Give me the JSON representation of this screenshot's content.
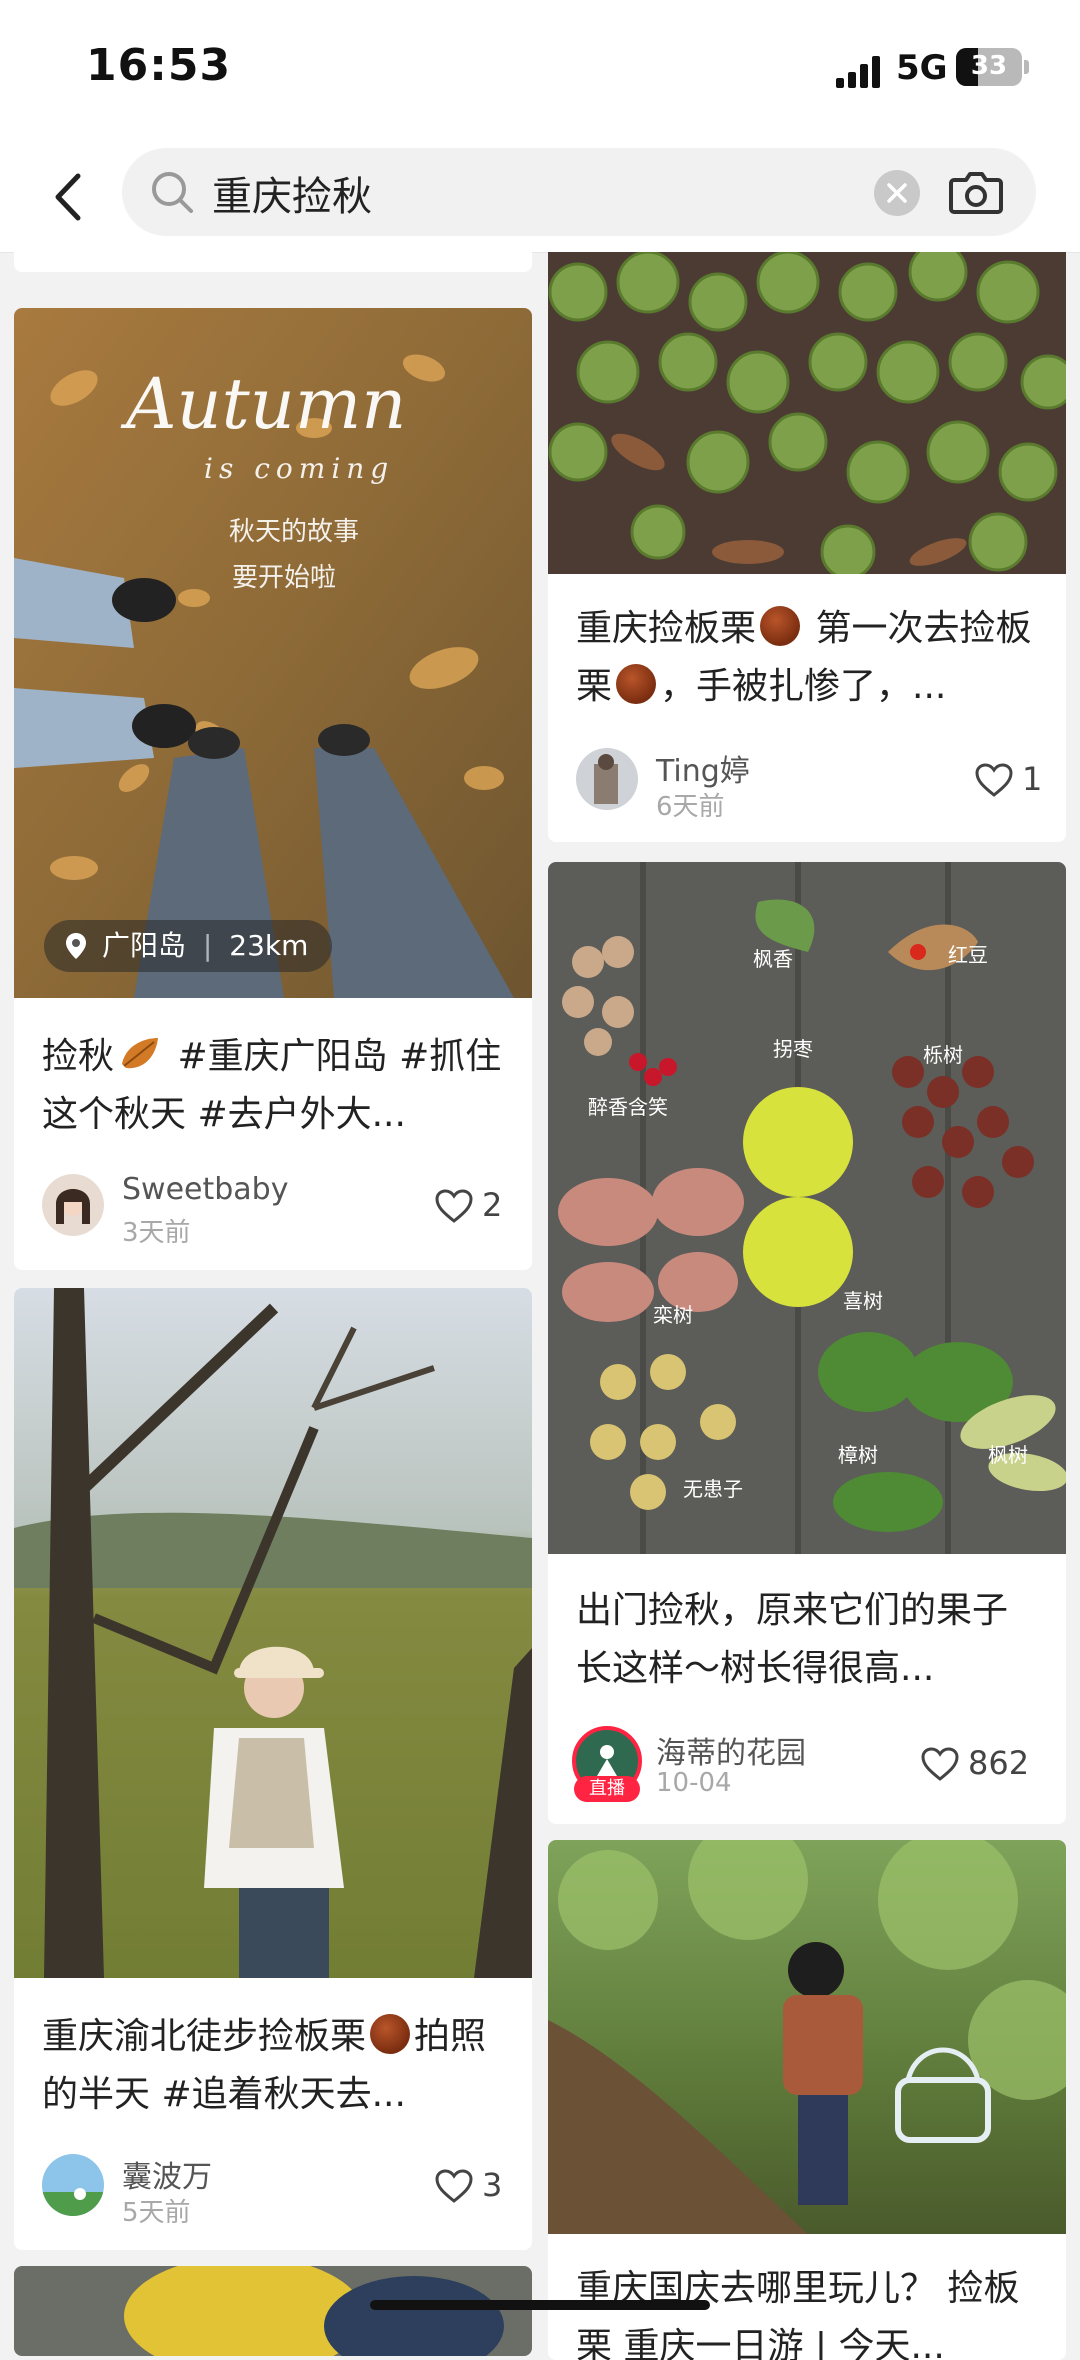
{
  "status_bar": {
    "time": "16:53",
    "network": "5G",
    "battery": "33",
    "battery_level": 0.33
  },
  "search": {
    "query": "重庆捡秋"
  },
  "left_column": [
    {
      "location": "广阳岛",
      "distance": "23km",
      "title_parts": [
        "捡秋",
        " #重庆广阳岛 #抓住这个秋天 #去户外大..."
      ],
      "author": "Sweetbaby",
      "date": "3天前",
      "likes": "2",
      "image_text": {
        "line1": "Autumn",
        "line2": "is coming",
        "line3": "秋天的故事",
        "line4": "要开始啦"
      }
    },
    {
      "title_parts": [
        "重庆渝北徒步捡板栗",
        "拍照的半天 #追着秋天去..."
      ],
      "author": "囊波万",
      "date": "5天前",
      "likes": "3"
    }
  ],
  "right_column": [
    {
      "title_parts": [
        "重庆捡板栗",
        " 第一次去捡板栗",
        "，手被扎惨了，..."
      ],
      "author": "Ting婷",
      "date": "6天前",
      "likes": "1"
    },
    {
      "title": "出门捡秋，原来它们的果子长这样～树长得很高...",
      "author": "海蒂的花园",
      "date": "10-04",
      "likes": "862",
      "live_badge": "直播",
      "image_labels": [
        "枫香",
        "红豆",
        "拐枣",
        "栎树",
        "醉香含笑",
        "栾树",
        "喜树",
        "樟树",
        "枫树",
        "无患子"
      ]
    },
    {
      "title": "重庆国庆去哪里玩儿？ 捡板栗 重庆一日游 | 今天..."
    }
  ],
  "colors": {
    "accent": "#ff2442",
    "background": "#f2f2f2",
    "card": "#ffffff"
  }
}
